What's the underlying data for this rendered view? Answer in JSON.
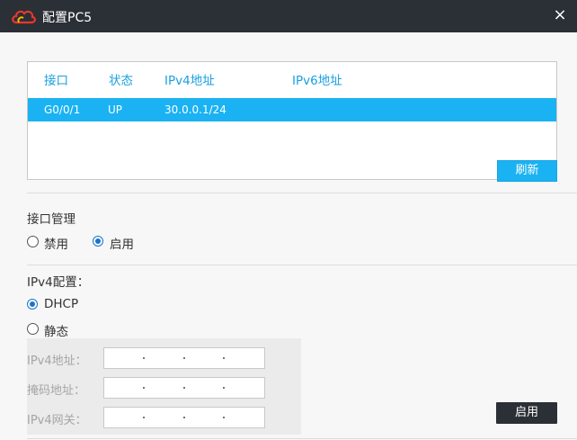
{
  "window": {
    "title": "配置PC5",
    "close_icon": "×"
  },
  "interface_table": {
    "headers": [
      "接口",
      "状态",
      "IPv4地址",
      "IPv6地址"
    ],
    "rows": [
      {
        "interface": "G0/0/1",
        "status": "UP",
        "ipv4": "30.0.0.1/24",
        "ipv6": ""
      }
    ],
    "refresh_label": "刷新"
  },
  "interface_mgmt": {
    "title": "接口管理",
    "options": [
      "禁用",
      "启用"
    ],
    "selected": "启用"
  },
  "ipv4_config": {
    "title": "IPv4配置：",
    "options": [
      "DHCP",
      "静态"
    ],
    "selected": "DHCP",
    "fields": {
      "address_label": "IPv4地址：",
      "mask_label": "掩码地址：",
      "gateway_label": "IPv4网关："
    },
    "apply_label": "启用"
  },
  "colors": {
    "accent": "#1ab2f2",
    "titlebar": "#2b2f36",
    "header_text": "#1a9fe0"
  }
}
